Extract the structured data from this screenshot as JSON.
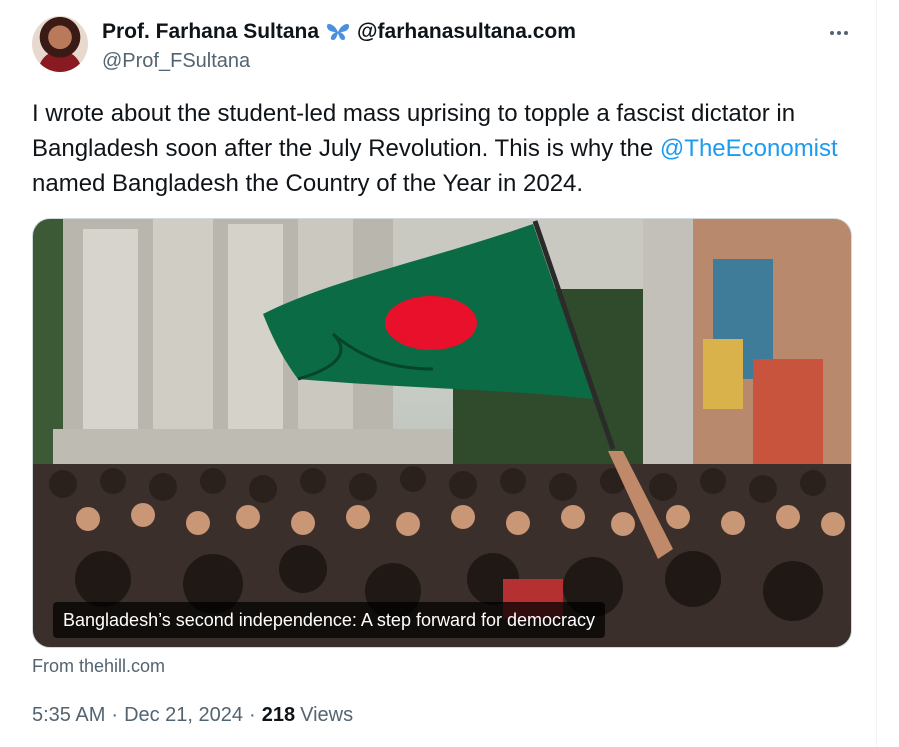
{
  "author": {
    "display_name": "Prof. Farhana Sultana",
    "badge_icon": "butterfly-icon",
    "name_suffix": "@farhanasultana.com",
    "handle": "@Prof_FSultana"
  },
  "more_icon": "more-horizontal-icon",
  "tweet": {
    "text_before": "I wrote about the student-led mass uprising to topple a fascist dictator in Bangladesh soon after the July Revolution. This is why the ",
    "mention": "@TheEconomist",
    "text_after": " named Bangladesh the Country of the Year in 2024."
  },
  "card": {
    "caption": "Bangladesh’s second independence: A step forward for democracy",
    "source": "From thehill.com"
  },
  "meta": {
    "time": "5:35 AM",
    "separator": "·",
    "date": "Dec 21, 2024",
    "views_count": "218",
    "views_label": "Views"
  },
  "colors": {
    "accent": "#1d9bf0",
    "secondary_text": "#536471",
    "flag_green": "#0b6b45",
    "flag_red": "#e8102a"
  }
}
